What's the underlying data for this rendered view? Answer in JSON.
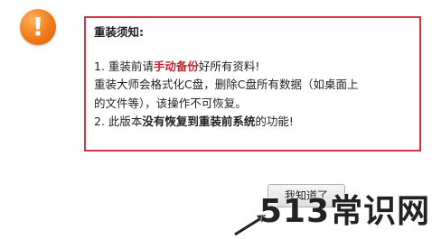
{
  "notice": {
    "title": "重装须知:",
    "item1_prefix": "1. 重装前请",
    "item1_highlight": "手动备份",
    "item1_suffix": "好所有资料!",
    "desc_line1": "重装大师会格式化C盘，删除C盘所有数据（如桌面上",
    "desc_line2": "的文件等），该操作不可恢复。",
    "item2_prefix": "2. 此版本",
    "item2_bold": "没有恢复到重装前系统",
    "item2_suffix": "的功能!"
  },
  "buttons": {
    "next_label": "我知道了"
  },
  "watermark": {
    "text": "513常识网"
  },
  "colors": {
    "border_red": "#d9343d",
    "highlight_red": "#c3272f",
    "icon_orange": "#f07a18"
  }
}
